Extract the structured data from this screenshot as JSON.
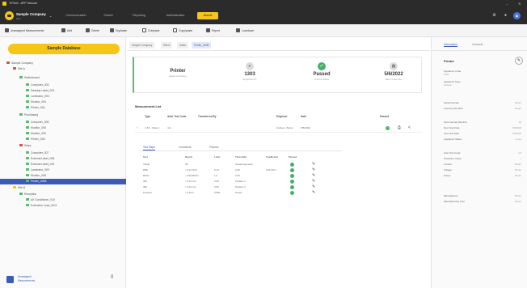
{
  "window": {
    "title": "TriTech - APP Manual",
    "controls": [
      "–",
      "✕"
    ]
  },
  "company": {
    "name": "Sample Company",
    "sub": "Test",
    "caret": "⌄"
  },
  "nav": {
    "tabs": [
      {
        "label": "Communication"
      },
      {
        "label": "Search"
      },
      {
        "label": "Reporting"
      },
      {
        "label": "Administration"
      },
      {
        "label": "Assets"
      }
    ],
    "active_tab": "Assets",
    "icons": [
      "gear-icon",
      "bell-icon",
      "user-icon"
    ],
    "icon_glyphs": [
      "⚙",
      "●",
      "◉"
    ]
  },
  "toolbar": {
    "items": [
      {
        "label": "Unassigned Measurements",
        "icon": "list-icon"
      },
      {
        "label": "Add",
        "icon": "add-icon"
      },
      {
        "label": "Delete",
        "icon": "trash-icon"
      },
      {
        "label": "Duplicate",
        "icon": "duplicate-icon"
      },
      {
        "label": "Cut/paste",
        "icon": "cut-icon"
      },
      {
        "label": "Copy/paste",
        "icon": "copy-icon"
      },
      {
        "label": "Report",
        "icon": "report-icon"
      },
      {
        "label": "Lockdown",
        "icon": "lock-icon"
      }
    ]
  },
  "sidebar": {
    "sample_button": "Sample Database",
    "tree": [
      {
        "label": "Sample Company",
        "level": 0,
        "color": "#d9534f"
      },
      {
        "label": "Site A",
        "level": 1,
        "color": "#d9534f"
      },
      {
        "label": "Switchboard",
        "level": 2,
        "color": "#5bb974"
      },
      {
        "label": "Computer_003",
        "level": 3,
        "color": "#5bb974"
      },
      {
        "label": "Desktop Label_003",
        "level": 3,
        "color": "#5bb974"
      },
      {
        "label": "Laminator_003",
        "level": 3,
        "color": "#5bb974"
      },
      {
        "label": "Monitor_004",
        "level": 3,
        "color": "#5bb974"
      },
      {
        "label": "Printer_004",
        "level": 3,
        "color": "#5bb974"
      },
      {
        "label": "Purchasing",
        "level": 2,
        "color": "#5bb974"
      },
      {
        "label": "Computer_005",
        "level": 3,
        "color": "#5bb974"
      },
      {
        "label": "Monitor_005",
        "level": 3,
        "color": "#5bb974"
      },
      {
        "label": "Monitor_006",
        "level": 3,
        "color": "#5bb974"
      },
      {
        "label": "Printer_005",
        "level": 3,
        "color": "#5bb974"
      },
      {
        "label": "Sales",
        "level": 2,
        "color": "#d9534f"
      },
      {
        "label": "Computer_007",
        "level": 3,
        "color": "#5bb974"
      },
      {
        "label": "External Label_008",
        "level": 3,
        "color": "#5bb974"
      },
      {
        "label": "External Label_009",
        "level": 3,
        "color": "#5bb974"
      },
      {
        "label": "Laminator_009",
        "level": 3,
        "color": "#5bb974"
      },
      {
        "label": "Monitor_008",
        "level": 3,
        "color": "#5bb974"
      },
      {
        "label": "Printer_0008",
        "level": 3,
        "color": "#5bb974",
        "selected": true
      },
      {
        "label": "Site B",
        "level": 1,
        "color": "#f5c518"
      },
      {
        "label": "Reception",
        "level": 2,
        "color": "#5bb974"
      },
      {
        "label": "Air Conditioner_010",
        "level": 3,
        "color": "#5bb974"
      },
      {
        "label": "Extension Lead_0011",
        "level": 3,
        "color": "#5bb974"
      }
    ],
    "footer_line1": "Unassigned",
    "footer_line2": "Measurements",
    "footer_count": "0"
  },
  "breadcrumb": [
    "Sample Company",
    "Site A",
    "Sales",
    "Printer_0008"
  ],
  "summary": {
    "cells": [
      {
        "big": "Printer",
        "small": "Equipment Name",
        "icon": "none"
      },
      {
        "big": "1303",
        "small": "Equipment ID",
        "icon": "barcode-icon",
        "glyph": "≡"
      },
      {
        "big": "Passed",
        "small": "Current Status",
        "icon": "check-icon",
        "glyph": "✓"
      },
      {
        "big": "5/6/2022",
        "small": "Date of Last Test",
        "icon": "calendar-icon",
        "glyph": "▦"
      }
    ]
  },
  "measurements": {
    "title": "Measurement List",
    "headers": [
      "Type",
      "Auto Test Code",
      "Transferred By",
      "Engineer",
      "Date",
      "Passed"
    ],
    "row": [
      "1.34 - Class I",
      "n/a",
      "",
      "Colleen_Tester",
      "5/6/2022"
    ],
    "row_icons": [
      "check-icon",
      "print-icon",
      "share-icon"
    ],
    "row_glyphs": [
      "✓",
      "⎙",
      "<"
    ]
  },
  "subtabs": [
    "Test Steps",
    "Comments",
    "Pictures"
  ],
  "steps": {
    "headers": [
      "Test",
      "Result",
      "Limit",
      "Threshold",
      "Coefficient",
      "Passed"
    ],
    "rows": [
      [
        "Visual",
        "OK",
        "",
        "Visual Inspection",
        "",
        ""
      ],
      [
        "RPE",
        "< 0.01 Ohm",
        "0.10",
        "0.30",
        "0.30 Ohm",
        ""
      ],
      [
        "RISO",
        "> 200 MOhm",
        "1.0",
        "0.30",
        "",
        ""
      ],
      [
        "IPE",
        "< 0.01 mA",
        "3.50",
        "Position 1",
        "",
        ""
      ],
      [
        "IPE",
        "< 0.01 mA",
        "3.50",
        "Position 2",
        "",
        ""
      ],
      [
        "Function",
        "< 0.10 A",
        "0.500",
        "Power",
        "",
        ""
      ]
    ],
    "pen_glyph": "✎"
  },
  "right_panel": {
    "tabs": [
      "Information",
      "Contacts"
    ],
    "title": "Printer",
    "edit_glyph": "✎",
    "fields": [
      {
        "label": "Appliance Code",
        "sub": "1303"
      },
      {
        "label": "Appliance Type",
        "sub": "Generic"
      }
    ],
    "props": [
      [
        "Serial Number",
        "Printer"
      ],
      [
        "Inventory Number",
        "Printer"
      ],
      [
        "Test Interval (Months)",
        "12"
      ],
      [
        "Next Test Date",
        "5/6/2023"
      ],
      [
        "Last Test Date",
        "5/6/2022"
      ],
      [
        "Appliance Status",
        "In use"
      ],
      [
        "Auto Test Code",
        "n/a"
      ],
      [
        "Protection Class",
        "I"
      ],
      [
        "Current",
        "Printer"
      ],
      [
        "Voltage",
        "Printer"
      ],
      [
        "Power",
        "Printer"
      ],
      [
        "Manufacturer",
        "Printer"
      ],
      [
        "Manufacturing Year",
        "Printer"
      ]
    ]
  },
  "colors": {
    "accent": "#f5c518",
    "dark": "#2b2b2b",
    "selected": "#3a5bb8",
    "pass": "#46b06b"
  }
}
